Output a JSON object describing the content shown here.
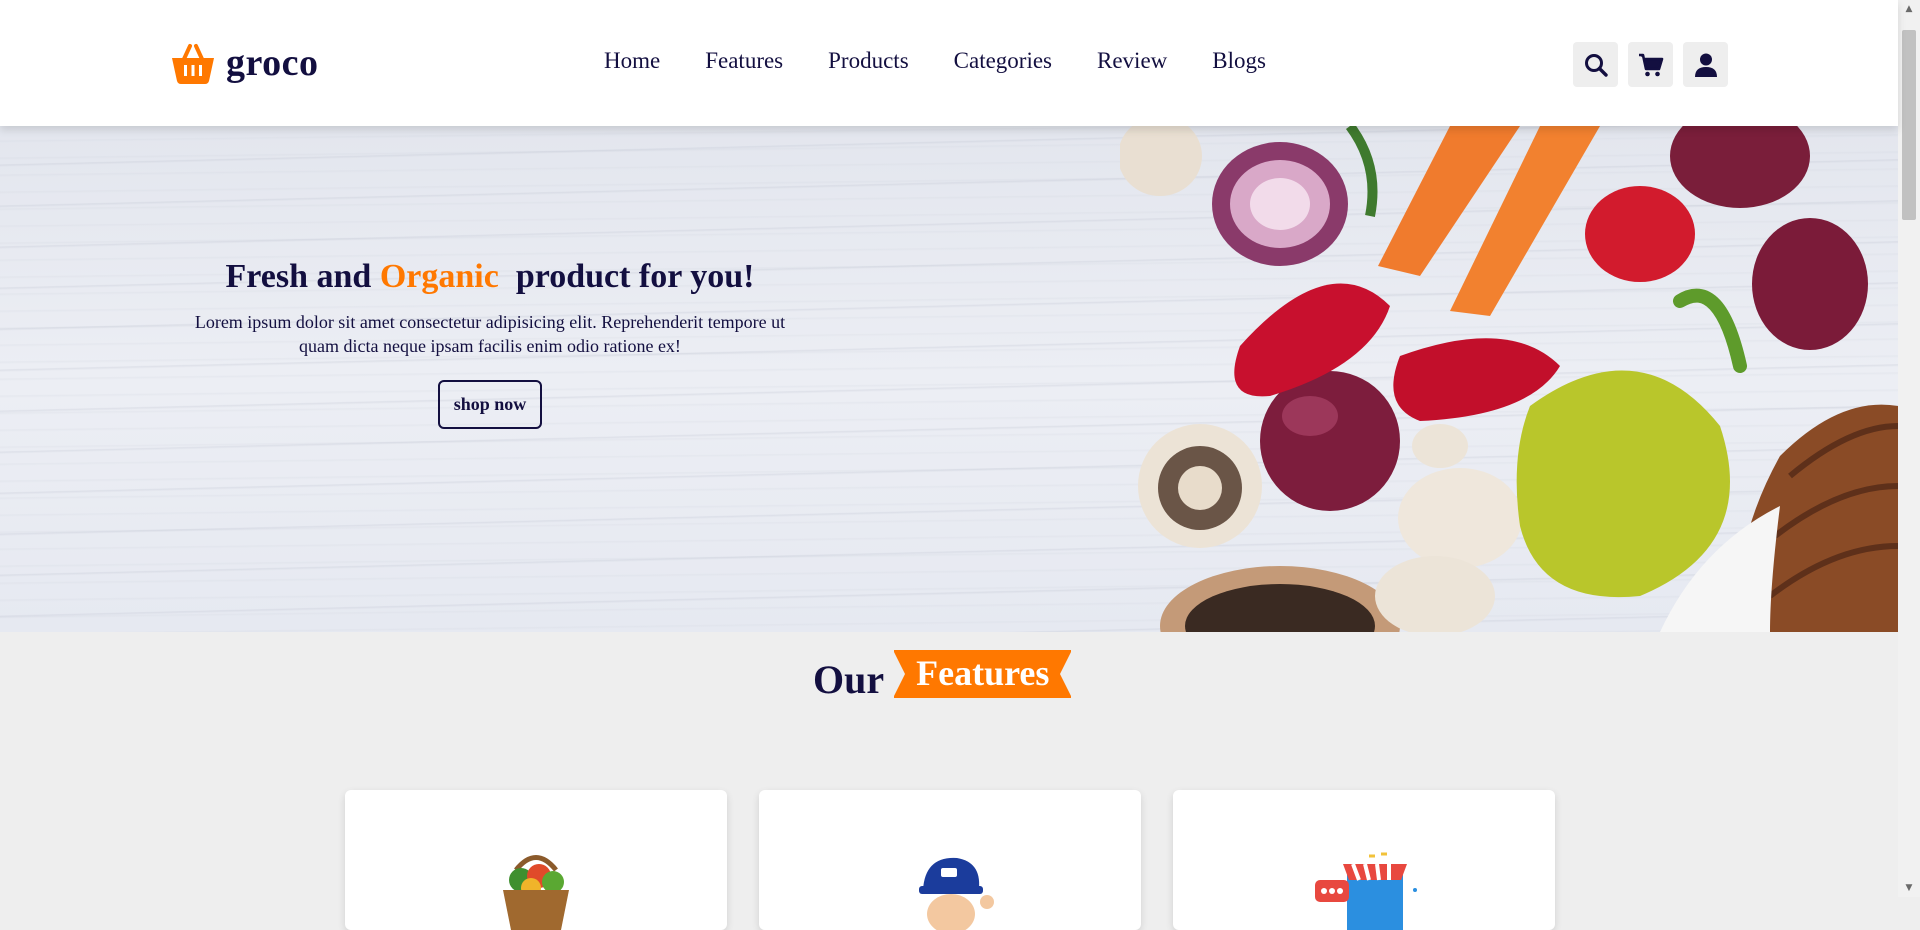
{
  "brand": {
    "name": "groco",
    "icon": "basket-icon",
    "accent": "#ff7800",
    "text_color": "#130f40"
  },
  "nav": {
    "items": [
      {
        "label": "Home"
      },
      {
        "label": "Features"
      },
      {
        "label": "Products"
      },
      {
        "label": "Categories"
      },
      {
        "label": "Review"
      },
      {
        "label": "Blogs"
      }
    ]
  },
  "header_icons": [
    "search-icon",
    "cart-icon",
    "user-icon"
  ],
  "hero": {
    "title_part1": "Fresh and",
    "title_accent": "Organic",
    "title_part2": "product for you!",
    "description": "Lorem ipsum dolor sit amet consectetur adipisicing elit. Reprehenderit tempore ut quam dicta neque ipsam facilis enim odio ratione ex!",
    "button_label": "shop now"
  },
  "features": {
    "heading_word": "Our",
    "heading_tag": "Features",
    "cards": [
      {
        "icon": "vegetable-basket-icon"
      },
      {
        "icon": "delivery-man-icon"
      },
      {
        "icon": "online-store-icon"
      }
    ]
  }
}
